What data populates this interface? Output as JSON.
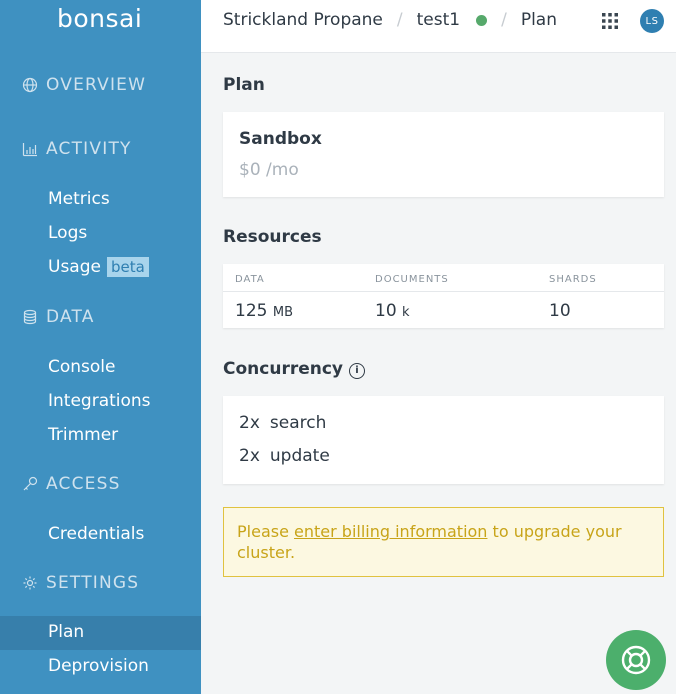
{
  "sidebar": {
    "logo": "bonsai",
    "sections": {
      "overview": "OVERVIEW",
      "activity": "ACTIVITY",
      "data": "DATA",
      "access": "ACCESS",
      "settings": "SETTINGS"
    },
    "items": {
      "metrics": "Metrics",
      "logs": "Logs",
      "usage": "Usage",
      "usage_badge": "beta",
      "console": "Console",
      "integrations": "Integrations",
      "trimmer": "Trimmer",
      "credentials": "Credentials",
      "plan": "Plan",
      "deprovision": "Deprovision"
    }
  },
  "header": {
    "breadcrumbs": [
      "Strickland Propane",
      "test1",
      "Plan"
    ],
    "separator": "/",
    "status_color": "#56a96b",
    "avatar_initials": "LS"
  },
  "main": {
    "plan": {
      "heading": "Plan",
      "name": "Sandbox",
      "price": "$0",
      "period": "/mo"
    },
    "resources": {
      "heading": "Resources",
      "columns": [
        "DATA",
        "DOCUMENTS",
        "SHARDS"
      ],
      "values": [
        {
          "number": "125",
          "unit": "MB"
        },
        {
          "number": "10",
          "unit": "k"
        },
        {
          "number": "10",
          "unit": ""
        }
      ]
    },
    "concurrency": {
      "heading": "Concurrency",
      "rows": [
        {
          "mult": "2x",
          "label": "search"
        },
        {
          "mult": "2x",
          "label": "update"
        }
      ]
    },
    "alert": {
      "prefix": "Please ",
      "link": "enter billing information",
      "suffix": " to upgrade your cluster."
    }
  },
  "colors": {
    "sidebar": "#3f91c1",
    "alert_border": "#e0c23f",
    "help_button": "#4caf6c"
  }
}
